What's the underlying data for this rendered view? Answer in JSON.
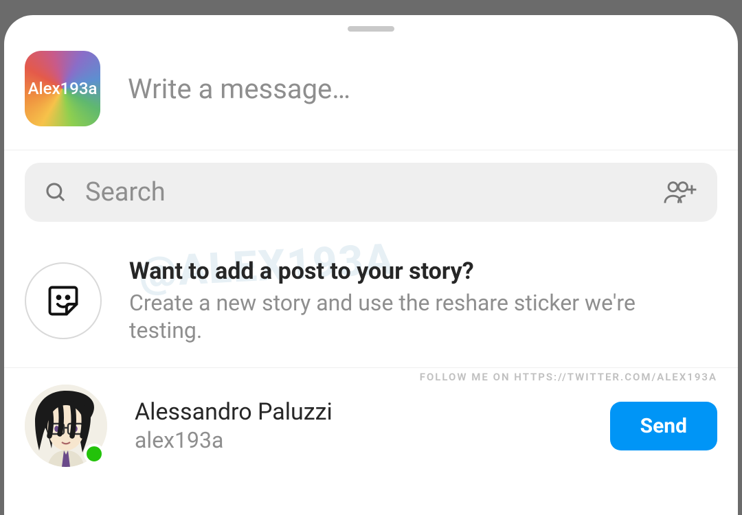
{
  "compose": {
    "avatar_label": "Alex193a",
    "placeholder": "Write a message…"
  },
  "search": {
    "placeholder": "Search"
  },
  "story_prompt": {
    "title": "Want to add a post to your story?",
    "subtitle": "Create a new story and use the reshare sticker we're testing."
  },
  "watermark": "@ALEX193A",
  "follow_banner": "FOLLOW ME ON HTTPS://TWITTER.COM/ALEX193A",
  "contact": {
    "name": "Alessandro Paluzzi",
    "handle": "alex193a",
    "send_label": "Send"
  }
}
